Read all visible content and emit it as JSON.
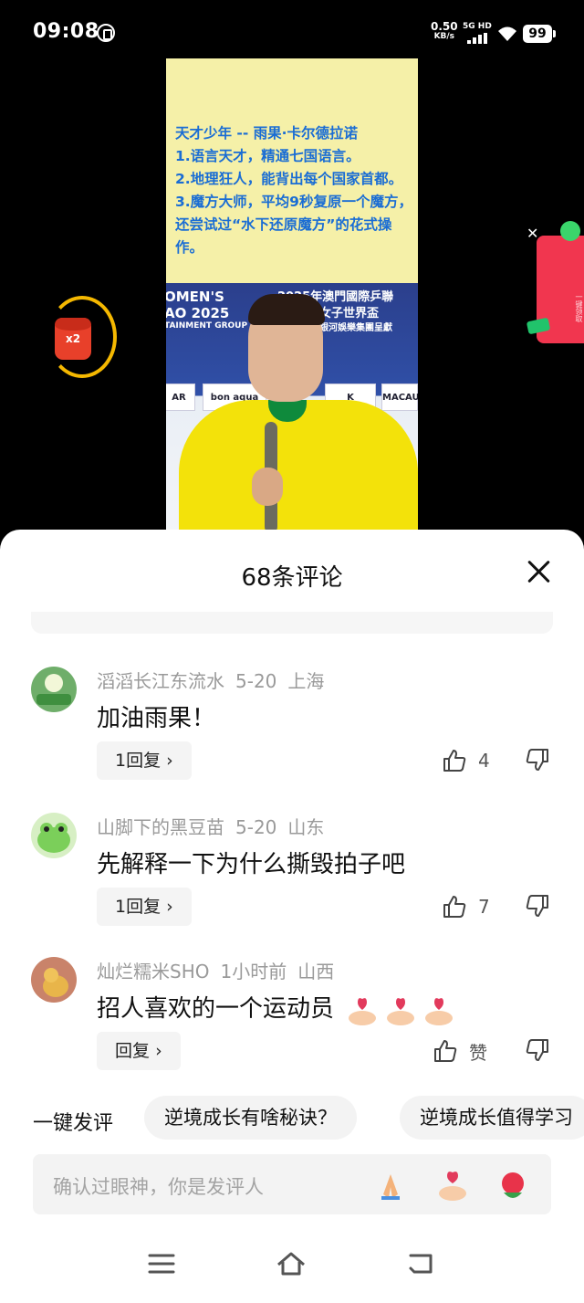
{
  "status_bar": {
    "time": "09:08",
    "net_speed": "0.50",
    "net_unit": "KB/s",
    "network": "5G HD",
    "battery": "99",
    "icons": [
      "app-indicator-icon",
      "signal-icon",
      "wifi-icon",
      "battery-icon"
    ]
  },
  "video": {
    "caption_lines": [
      "天才少年 -- 雨果·卡尔德拉诺",
      "1.语言天才，精通七国语言。",
      "2.地理狂人，能背出每个国家首都。",
      "3.魔方大师，平均9秒复原一个魔方，还尝试过“水下还原魔方”的花式操作。"
    ],
    "backdrop_line1": "2025年澳門國際乒聯",
    "backdrop_line2": "女子世界盃",
    "backdrop_line3": "銀河娛樂集團呈獻",
    "backdrop_left1": "OMEN'S",
    "backdrop_left2": "AO 2025",
    "backdrop_left3": "TAINMENT GROUP",
    "sponsors": [
      "AR",
      "bon aqua",
      "K",
      "MACAU"
    ],
    "red_packet_label": "x2",
    "side_ad_text": "一键领取"
  },
  "comments_panel": {
    "title": "68条评论",
    "comments": [
      {
        "user": "滔滔长江东流水",
        "date": "5-20",
        "location": "上海",
        "text": "加油雨果！",
        "reply_label": "1回复",
        "likes": "4",
        "avatar_color": "#6fae6a"
      },
      {
        "user": "山脚下的黑豆苗",
        "date": "5-20",
        "location": "山东",
        "text": "先解释一下为什么撕毁拍子吧",
        "reply_label": "1回复",
        "likes": "7",
        "avatar_color": "#7bcf5a"
      },
      {
        "user": "灿烂糯米SHO",
        "date": "1小时前",
        "location": "山西",
        "text": "招人喜欢的一个运动员",
        "reply_label": "回复",
        "likes": "赞",
        "avatar_color": "#c9836a"
      }
    ],
    "quick_comment_label": "一键发评",
    "quick_chips": [
      "逆境成长有啥秘诀？",
      "逆境成长值得学习"
    ],
    "input_placeholder": "确认过眼神，你是发评人",
    "input_emojis": [
      "pray-emoji",
      "finger-heart-emoji",
      "rose-emoji"
    ]
  },
  "nav_bar": {
    "icons": [
      "menu-icon",
      "home-icon",
      "back-icon"
    ]
  },
  "colors": {
    "caption_blue": "#1a6dd4",
    "panel_bg": "#ffffff",
    "muted_text": "#9a9a9a",
    "chip_bg": "#f3f3f3"
  }
}
